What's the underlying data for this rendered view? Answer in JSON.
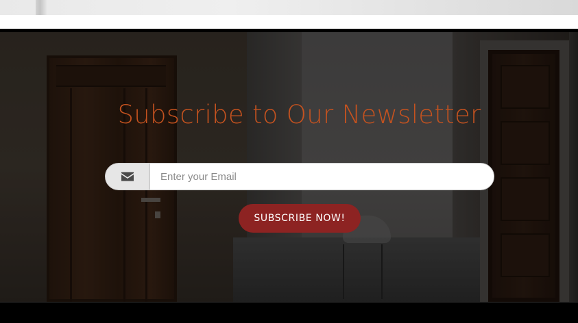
{
  "newsletter": {
    "title": "Subscribe to Our Newsletter",
    "email_placeholder": "Enter your Email",
    "email_value": "",
    "subscribe_label": "SUBSCRIBE NOW!",
    "addon_icon": "envelope-icon"
  },
  "colors": {
    "title": "#c4521f",
    "button": "#8d2322",
    "addon_bg": "#e6e6e6"
  }
}
